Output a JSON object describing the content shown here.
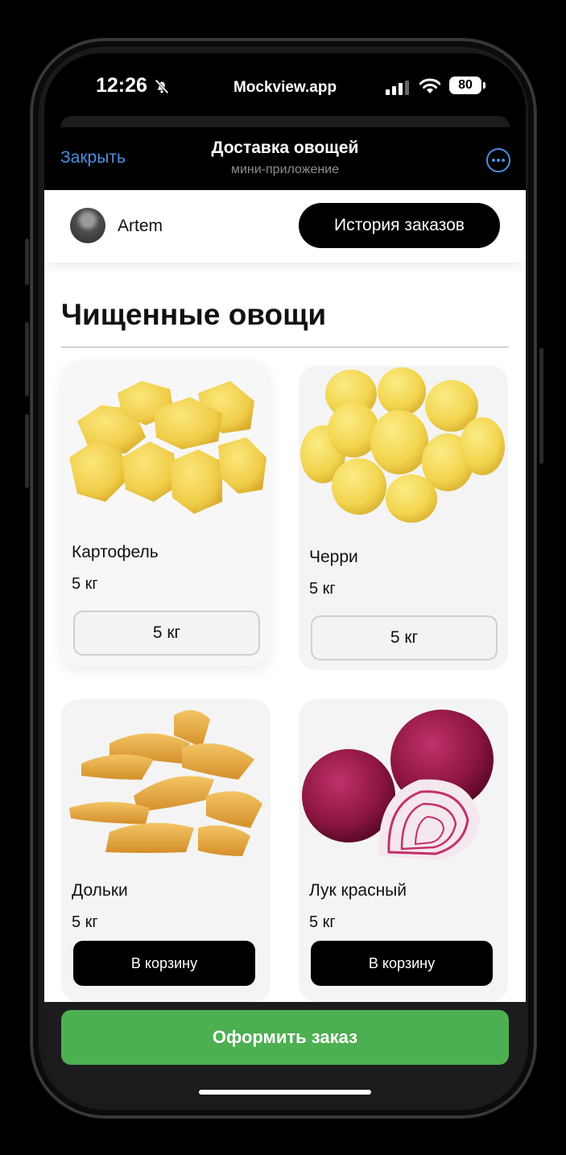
{
  "status_bar": {
    "time": "12:26",
    "host": "Mockview.app",
    "battery": "80"
  },
  "header": {
    "close_label": "Закрыть",
    "title": "Доставка овощей",
    "subtitle": "мини-приложение",
    "more_icon": "more-circle-icon"
  },
  "user": {
    "name": "Artem",
    "history_label": "История заказов"
  },
  "section": {
    "title": "Чищенные овощи"
  },
  "products": [
    {
      "name": "Картофель",
      "weight": "5 кг",
      "action": "5 кг",
      "action_type": "weight-select"
    },
    {
      "name": "Черри",
      "weight": "5 кг",
      "action": "5 кг",
      "action_type": "weight-select"
    },
    {
      "name": "Дольки",
      "weight": "5 кг",
      "action": "В корзину",
      "action_type": "add-to-cart"
    },
    {
      "name": "Лук красный",
      "weight": "5 кг",
      "action": "В корзину",
      "action_type": "add-to-cart"
    }
  ],
  "checkout": {
    "label": "Оформить заказ",
    "color": "#4caf50"
  },
  "colors": {
    "accent": "#4a90e2",
    "checkout_green": "#4caf50"
  }
}
